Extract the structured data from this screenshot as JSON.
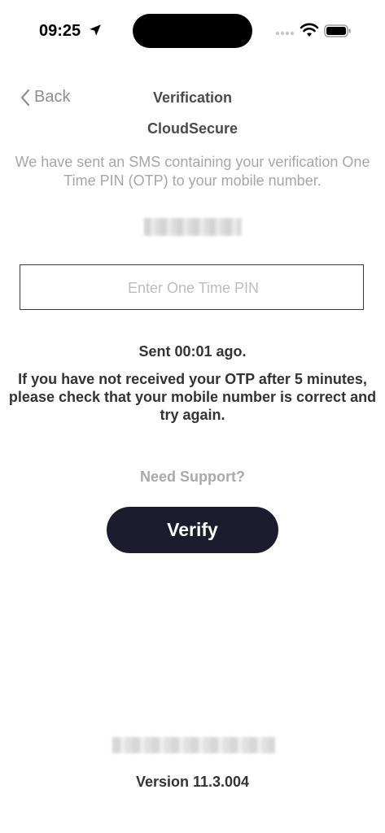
{
  "status_bar": {
    "time": "09:25",
    "icons": [
      "location-arrow-icon",
      "cellular-signal-icon",
      "wifi-icon",
      "battery-icon"
    ]
  },
  "nav": {
    "back_label": "Back",
    "title": "Verification"
  },
  "app_name": "CloudSecure",
  "info_text": "We have sent an SMS containing your verification One Time PIN (OTP) to your mobile number.",
  "otp": {
    "value": "",
    "placeholder": "Enter One Time PIN"
  },
  "sent_text": "Sent 00:01 ago.",
  "notice_text": "If you have not received your OTP after 5 minutes, please check that your mobile number is correct and try again.",
  "support_label": "Need Support?",
  "verify_label": "Verify",
  "version_text": "Version 11.3.004",
  "colors": {
    "button_bg": "#1d1c2e",
    "muted_text": "#a6a6a6",
    "body_text": "#333333",
    "caret": "#3b5bdb"
  }
}
